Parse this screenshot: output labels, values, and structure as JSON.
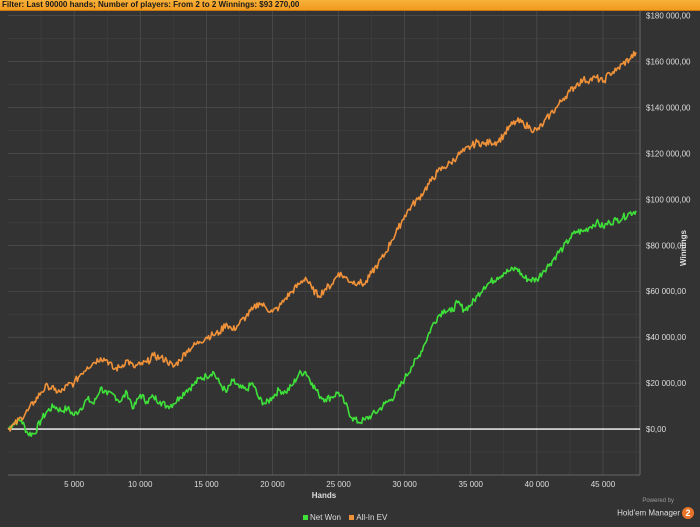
{
  "filter_text": "Filter: Last 90000 hands; Number of players: From 2 to 2 Winnings: $93 270,00",
  "brand": {
    "powered_by": "Powered by",
    "name": "Hold'em Manager",
    "badge": "2"
  },
  "colors": {
    "net_won": "#3fe03a",
    "all_in_ev": "#f0923a",
    "zero_line": "#ffffff",
    "grid": "#555555",
    "background": "#333333",
    "filter_bar": "#f5a52a"
  },
  "chart_data": {
    "type": "line",
    "xlabel": "Hands",
    "ylabel": "Winnings",
    "xlim": [
      0,
      47800
    ],
    "ylim": [
      -20000,
      182000
    ],
    "x_ticks": [
      5000,
      10000,
      15000,
      20000,
      25000,
      30000,
      35000,
      40000,
      45000
    ],
    "x_tick_labels": [
      "5 000",
      "10 000",
      "15 000",
      "20 000",
      "25 000",
      "30 000",
      "35 000",
      "40 000",
      "45 000"
    ],
    "y_ticks": [
      0,
      20000,
      40000,
      60000,
      80000,
      100000,
      120000,
      140000,
      160000,
      180000
    ],
    "y_tick_labels": [
      "$0,00",
      "$20 000,00",
      "$40 000,00",
      "$60 000,00",
      "$80 000,00",
      "$100 000,00",
      "$120 000,00",
      "$140 000,00",
      "$160 000,00",
      "$180 000,00"
    ],
    "grid": true,
    "legend_position": "bottom",
    "series": [
      {
        "name": "Net Won",
        "color": "#3fe03a",
        "points": [
          [
            0,
            0
          ],
          [
            500,
            3000
          ],
          [
            1000,
            4000
          ],
          [
            1500,
            -2000
          ],
          [
            2000,
            -2000
          ],
          [
            2500,
            4000
          ],
          [
            3000,
            8000
          ],
          [
            3500,
            10000
          ],
          [
            4000,
            8000
          ],
          [
            4500,
            9000
          ],
          [
            5000,
            6000
          ],
          [
            5500,
            9000
          ],
          [
            6000,
            13000
          ],
          [
            6500,
            11000
          ],
          [
            7000,
            18000
          ],
          [
            7500,
            15000
          ],
          [
            8000,
            15000
          ],
          [
            8500,
            12000
          ],
          [
            9000,
            16000
          ],
          [
            9500,
            9000
          ],
          [
            10000,
            15000
          ],
          [
            10500,
            12000
          ],
          [
            11000,
            14000
          ],
          [
            11500,
            12000
          ],
          [
            12000,
            10000
          ],
          [
            12500,
            11000
          ],
          [
            13000,
            14000
          ],
          [
            13500,
            17000
          ],
          [
            14000,
            19000
          ],
          [
            14500,
            22000
          ],
          [
            15000,
            23000
          ],
          [
            15500,
            25000
          ],
          [
            16000,
            20000
          ],
          [
            16500,
            16000
          ],
          [
            17000,
            21000
          ],
          [
            17500,
            18000
          ],
          [
            18000,
            17000
          ],
          [
            18500,
            20000
          ],
          [
            19000,
            13000
          ],
          [
            19500,
            11000
          ],
          [
            20000,
            14000
          ],
          [
            20500,
            17000
          ],
          [
            21000,
            16000
          ],
          [
            21500,
            19000
          ],
          [
            22000,
            24000
          ],
          [
            22500,
            25000
          ],
          [
            23000,
            20000
          ],
          [
            23500,
            15000
          ],
          [
            24000,
            13000
          ],
          [
            24500,
            14000
          ],
          [
            25000,
            16000
          ],
          [
            25500,
            11000
          ],
          [
            26000,
            5000
          ],
          [
            26500,
            3000
          ],
          [
            27000,
            4000
          ],
          [
            27500,
            6000
          ],
          [
            28000,
            8000
          ],
          [
            28500,
            11000
          ],
          [
            29000,
            13000
          ],
          [
            29500,
            17000
          ],
          [
            30000,
            22000
          ],
          [
            30500,
            27000
          ],
          [
            31000,
            31000
          ],
          [
            31500,
            37000
          ],
          [
            32000,
            44000
          ],
          [
            32500,
            49000
          ],
          [
            33000,
            52000
          ],
          [
            33500,
            51000
          ],
          [
            34000,
            55000
          ],
          [
            34500,
            52000
          ],
          [
            35000,
            54000
          ],
          [
            35500,
            58000
          ],
          [
            36000,
            62000
          ],
          [
            36500,
            64000
          ],
          [
            37000,
            66000
          ],
          [
            37500,
            68000
          ],
          [
            38000,
            69000
          ],
          [
            38500,
            70000
          ],
          [
            39000,
            66000
          ],
          [
            39500,
            65000
          ],
          [
            40000,
            65000
          ],
          [
            40500,
            69000
          ],
          [
            41000,
            72000
          ],
          [
            41500,
            76000
          ],
          [
            42000,
            79000
          ],
          [
            42500,
            83000
          ],
          [
            43000,
            86000
          ],
          [
            43500,
            86000
          ],
          [
            44000,
            88000
          ],
          [
            44500,
            90000
          ],
          [
            45000,
            88000
          ],
          [
            45500,
            90000
          ],
          [
            46000,
            91000
          ],
          [
            46500,
            92000
          ],
          [
            47000,
            94000
          ],
          [
            47500,
            95000
          ]
        ]
      },
      {
        "name": "All-In EV",
        "color": "#f0923a",
        "points": [
          [
            0,
            0
          ],
          [
            500,
            2000
          ],
          [
            1000,
            5000
          ],
          [
            1500,
            8000
          ],
          [
            2000,
            12000
          ],
          [
            2500,
            16000
          ],
          [
            3000,
            19000
          ],
          [
            3500,
            17000
          ],
          [
            4000,
            16000
          ],
          [
            4500,
            19000
          ],
          [
            5000,
            20000
          ],
          [
            5500,
            24000
          ],
          [
            6000,
            27000
          ],
          [
            6500,
            29000
          ],
          [
            7000,
            31000
          ],
          [
            7500,
            30000
          ],
          [
            8000,
            26000
          ],
          [
            8500,
            27000
          ],
          [
            9000,
            30000
          ],
          [
            9500,
            27000
          ],
          [
            10000,
            28000
          ],
          [
            10500,
            29000
          ],
          [
            11000,
            32000
          ],
          [
            11500,
            31000
          ],
          [
            12000,
            30000
          ],
          [
            12500,
            27000
          ],
          [
            13000,
            30000
          ],
          [
            13500,
            34000
          ],
          [
            14000,
            36000
          ],
          [
            14500,
            38000
          ],
          [
            15000,
            40000
          ],
          [
            15500,
            41000
          ],
          [
            16000,
            42000
          ],
          [
            16500,
            46000
          ],
          [
            17000,
            43000
          ],
          [
            17500,
            46000
          ],
          [
            18000,
            49000
          ],
          [
            18500,
            52000
          ],
          [
            19000,
            55000
          ],
          [
            19500,
            53000
          ],
          [
            20000,
            51000
          ],
          [
            20500,
            53000
          ],
          [
            21000,
            57000
          ],
          [
            21500,
            60000
          ],
          [
            22000,
            63000
          ],
          [
            22500,
            66000
          ],
          [
            23000,
            61000
          ],
          [
            23500,
            58000
          ],
          [
            24000,
            61000
          ],
          [
            24500,
            63000
          ],
          [
            25000,
            68000
          ],
          [
            25500,
            66000
          ],
          [
            26000,
            64000
          ],
          [
            26500,
            64000
          ],
          [
            27000,
            63000
          ],
          [
            27500,
            68000
          ],
          [
            28000,
            72000
          ],
          [
            28500,
            76000
          ],
          [
            29000,
            82000
          ],
          [
            29500,
            87000
          ],
          [
            30000,
            93000
          ],
          [
            30500,
            97000
          ],
          [
            31000,
            100000
          ],
          [
            31500,
            104000
          ],
          [
            32000,
            108000
          ],
          [
            32500,
            112000
          ],
          [
            33000,
            114000
          ],
          [
            33500,
            116000
          ],
          [
            34000,
            119000
          ],
          [
            34500,
            121000
          ],
          [
            35000,
            123000
          ],
          [
            35500,
            125000
          ],
          [
            36000,
            124000
          ],
          [
            36500,
            125000
          ],
          [
            37000,
            125000
          ],
          [
            37500,
            128000
          ],
          [
            38000,
            132000
          ],
          [
            38500,
            134000
          ],
          [
            39000,
            133000
          ],
          [
            39500,
            131000
          ],
          [
            40000,
            130000
          ],
          [
            40500,
            133000
          ],
          [
            41000,
            137000
          ],
          [
            41500,
            140000
          ],
          [
            42000,
            144000
          ],
          [
            42500,
            147000
          ],
          [
            43000,
            150000
          ],
          [
            43500,
            152000
          ],
          [
            44000,
            152000
          ],
          [
            44500,
            153000
          ],
          [
            45000,
            151000
          ],
          [
            45500,
            155000
          ],
          [
            46000,
            156000
          ],
          [
            46500,
            159000
          ],
          [
            47000,
            161000
          ],
          [
            47500,
            164000
          ]
        ]
      }
    ]
  }
}
